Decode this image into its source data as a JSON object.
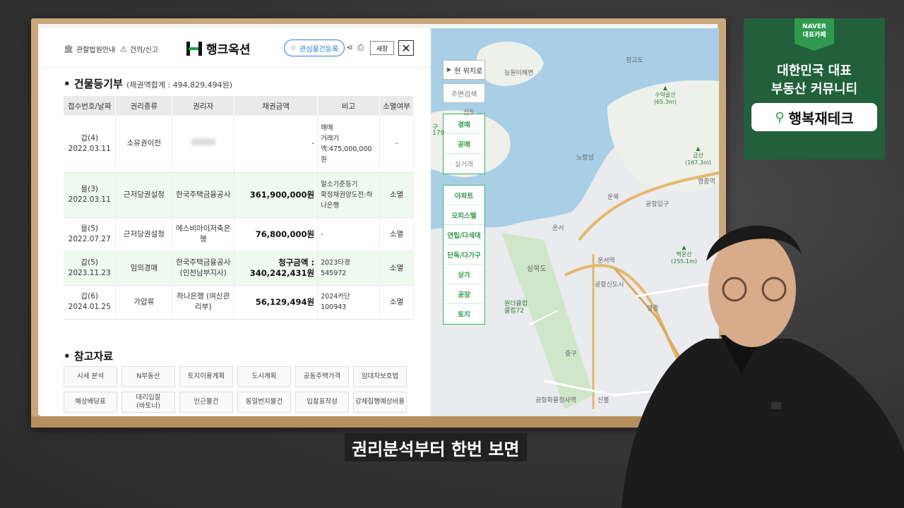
{
  "header": {
    "court_info": "관할법원안내",
    "report": "건의/신고",
    "logo_text": "행크옥션",
    "favorite": "관심물건등록",
    "new_window": "새창",
    "close": "✕"
  },
  "registry": {
    "title": "건물등기부",
    "subtitle": "(채권액합계 : 494,829,494원)",
    "columns": [
      "접수번호/날짜",
      "권리종류",
      "권리자",
      "채권금액",
      "비고",
      "소멸여부"
    ],
    "rows": [
      {
        "no": "갑(4)",
        "date": "2022.03.11",
        "type": "소유권이전",
        "holder": "",
        "amount": "-",
        "note": "매매\n거래가\n액:475,000,000\n원",
        "status": "-",
        "green": false
      },
      {
        "no": "을(3)",
        "date": "2022.03.11",
        "type": "근저당권설정",
        "holder": "한국주택금융공사",
        "amount": "361,900,000원",
        "note": "말소기준등기\n확정채권양도전:하\n나은행",
        "status": "소멸",
        "green": true
      },
      {
        "no": "을(5)",
        "date": "2022.07.27",
        "type": "근저당권설정",
        "holder": "에스비아이저축은\n행",
        "amount": "76,800,000원",
        "note": "-",
        "status": "소멸",
        "green": false
      },
      {
        "no": "갑(5)",
        "date": "2023.11.23",
        "type": "임의경매",
        "holder": "한국주택금융공사\n(인천남부지사)",
        "amount": "청구금액 :\n340,242,431원",
        "note": "2023타경\n545972",
        "status": "소멸",
        "green": true
      },
      {
        "no": "갑(6)",
        "date": "2024.01.25",
        "type": "가압류",
        "holder": "하나은행 (여신관\n리부)",
        "amount": "56,129,494원",
        "note": "2024카단\n100943",
        "status": "소멸",
        "green": false
      }
    ]
  },
  "reference": {
    "title": "참고자료",
    "buttons": [
      "시세 분석",
      "N부동산",
      "토지이용계획",
      "도시계획",
      "공동주택가격",
      "임대차보호법",
      "예상배당표",
      "대리입찰\n(바토너)",
      "인근물건",
      "동일번지물건",
      "입찰표작성",
      "강제집행예상비용"
    ]
  },
  "map": {
    "current_location": "현 위치로",
    "nearby_search": "주변검색",
    "trade_group": [
      "경매",
      "공매",
      "실거래"
    ],
    "type_group": [
      "아파트",
      "오피스텔",
      "연립/다세대",
      "단독/다가구",
      "상가",
      "공장",
      "토지"
    ],
    "labels": {
      "island1": "장고도",
      "island2": "능원이해변",
      "sindo": "신도",
      "noyangseom": "노랑섬",
      "samokdo": "삼목도",
      "unseo": "운서",
      "unseo_station": "운서역",
      "airport_entrance": "공항입구",
      "airport_newcity": "공항신도시",
      "yeongjong": "영종",
      "junggu": "중구",
      "cargo": "공항화물청사역",
      "sinbul": "신불",
      "unbuk": "운북",
      "yeongjong_station": "영종역",
      "wonder": "원더클럽\n클럽72",
      "gu_partial": "구",
      "num_partial": "179"
    },
    "mountains": [
      {
        "name": "수약골산",
        "height": "(65.3m)"
      },
      {
        "name": "금산",
        "height": "(167.3m)"
      },
      {
        "name": "백운산",
        "height": "(255.1m)"
      }
    ]
  },
  "naver": {
    "badge": "NAVER\n대표카페",
    "line1": "대한민국 대표",
    "line2": "부동산 커뮤니티",
    "pill": "행복재테크"
  },
  "subtitle": "권리분석부터 한번 보면"
}
